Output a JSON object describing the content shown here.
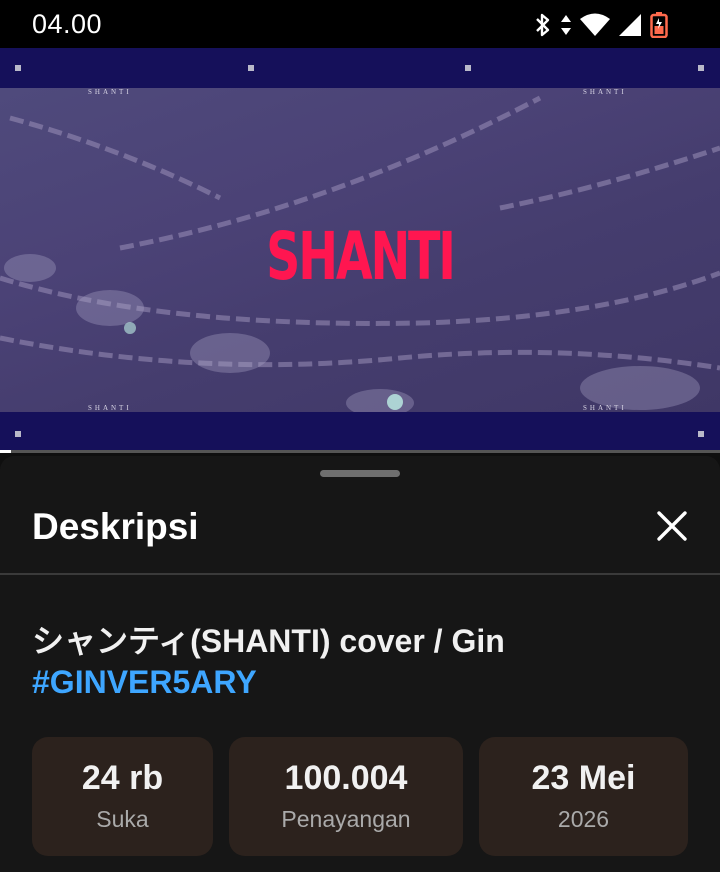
{
  "status_bar": {
    "time": "04.00",
    "icons": [
      "bluetooth-icon",
      "data-arrows-icon",
      "wifi-icon",
      "cell-signal-icon",
      "battery-charging-icon"
    ]
  },
  "video": {
    "title_text": "SHANTI",
    "corner_text": "SHANTI",
    "progress_fraction": 0.015,
    "colors": {
      "title": "#ff1650",
      "band": "#15105a"
    }
  },
  "sheet": {
    "title": "Deskripsi",
    "close_icon": "close-icon"
  },
  "description": {
    "video_title": "シャンティ(SHANTI) cover / Gin",
    "hashtag": "#GINVER5ARY",
    "hashtag_color": "#3ea6ff"
  },
  "stats": [
    {
      "value": "24 rb",
      "label": "Suka"
    },
    {
      "value": "100.004",
      "label": "Penayangan"
    },
    {
      "value": "23 Mei",
      "label": "2026"
    }
  ]
}
